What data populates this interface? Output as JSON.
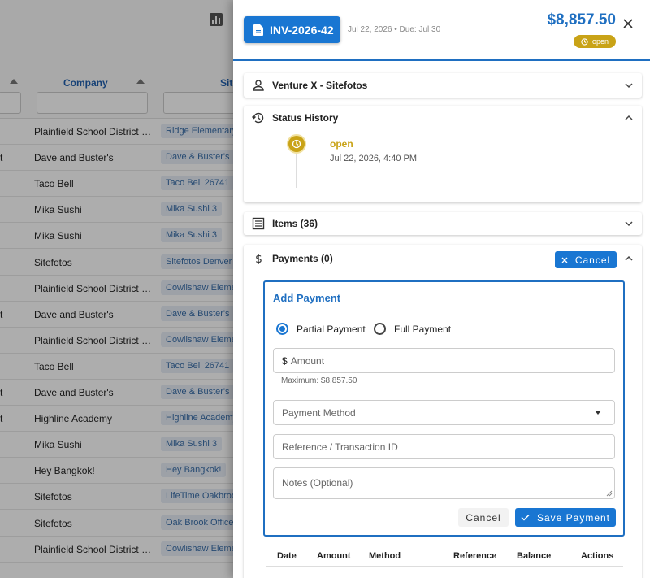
{
  "background_table": {
    "columns": [
      "Company",
      "Sit"
    ],
    "rows": [
      {
        "c0": "",
        "company": "Plainfield School District 2...",
        "site": "Ridge Elementary"
      },
      {
        "c0": "t",
        "company": "Dave and Buster's",
        "site": "Dave & Buster's"
      },
      {
        "c0": "",
        "company": "Taco Bell",
        "site": "Taco Bell 26741"
      },
      {
        "c0": "",
        "company": "Mika Sushi",
        "site": "Mika Sushi 3"
      },
      {
        "c0": "",
        "company": "Mika Sushi",
        "site": "Mika Sushi 3"
      },
      {
        "c0": "",
        "company": "Sitefotos",
        "site": "Sitefotos Denver"
      },
      {
        "c0": "",
        "company": "Plainfield School District 2...",
        "site": "Cowlishaw Elementary"
      },
      {
        "c0": "t",
        "company": "Dave and Buster's",
        "site": "Dave & Buster's"
      },
      {
        "c0": "",
        "company": "Plainfield School District 2...",
        "site": "Cowlishaw Elementary"
      },
      {
        "c0": "",
        "company": "Taco Bell",
        "site": "Taco Bell 26741"
      },
      {
        "c0": "t",
        "company": "Dave and Buster's",
        "site": "Dave & Buster's"
      },
      {
        "c0": "t",
        "company": "Highline Academy",
        "site": "Highline Academy"
      },
      {
        "c0": "",
        "company": "Mika Sushi",
        "site": "Mika Sushi 3"
      },
      {
        "c0": "",
        "company": "Hey Bangkok!",
        "site": "Hey Bangkok!"
      },
      {
        "c0": "",
        "company": "Sitefotos",
        "site": "LifeTime Oakbrook"
      },
      {
        "c0": "",
        "company": "Sitefotos",
        "site": "Oak Brook Office"
      },
      {
        "c0": "",
        "company": "Plainfield School District 2...",
        "site": "Cowlishaw Elementary"
      }
    ]
  },
  "invoice": {
    "number": "INV-2026-42",
    "dates": "Jul 22, 2026 • Due: Jul 30",
    "total": "$8,857.50",
    "status": "open"
  },
  "sections": {
    "client": {
      "title": "Venture X - Sitefotos"
    },
    "status_history": {
      "title": "Status History",
      "entries": [
        {
          "status": "open",
          "time": "Jul 22, 2026, 4:40 PM"
        }
      ]
    },
    "items": {
      "title": "Items (36)"
    },
    "payments": {
      "title": "Payments (0)",
      "cancel_label": "Cancel",
      "add_payment": {
        "title": "Add Payment",
        "partial_label": "Partial Payment",
        "full_label": "Full Payment",
        "selected": "partial",
        "amount_prefix": "$",
        "amount_placeholder": "Amount",
        "amount_help": "Maximum: $8,857.50",
        "method_placeholder": "Payment Method",
        "reference_placeholder": "Reference / Transaction ID",
        "notes_placeholder": "Notes (Optional)",
        "cancel_label": "Cancel",
        "save_label": "Save Payment"
      },
      "table_headers": [
        "Date",
        "Amount",
        "Method",
        "Reference",
        "Balance",
        "Actions"
      ]
    }
  },
  "colors": {
    "primary": "#1976d2",
    "status_open": "#c9a317"
  }
}
